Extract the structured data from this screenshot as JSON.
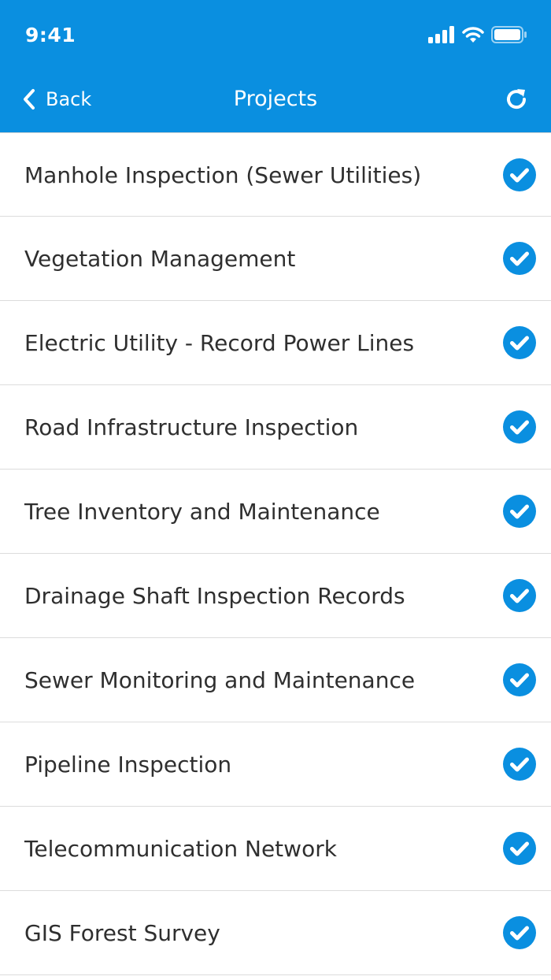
{
  "status_bar": {
    "time": "9:41",
    "icons": [
      "signal-icon",
      "wifi-icon",
      "battery-icon"
    ]
  },
  "nav": {
    "back_label": "Back",
    "title": "Projects",
    "back_icon": "chevron-left-icon",
    "refresh_icon": "refresh-icon"
  },
  "colors": {
    "header": "#0A8FE0",
    "check": "#0A8FE0",
    "text": "#2f2f2f",
    "divider": "#dcdcdc"
  },
  "projects": [
    {
      "label": "Manhole Inspection (Sewer Utilities)",
      "checked": true
    },
    {
      "label": "Vegetation Management",
      "checked": true
    },
    {
      "label": "Electric Utility - Record Power Lines",
      "checked": true
    },
    {
      "label": "Road Infrastructure Inspection",
      "checked": true
    },
    {
      "label": "Tree Inventory and Maintenance",
      "checked": true
    },
    {
      "label": "Drainage Shaft Inspection Records",
      "checked": true
    },
    {
      "label": "Sewer Monitoring and Maintenance",
      "checked": true
    },
    {
      "label": "Pipeline Inspection",
      "checked": true
    },
    {
      "label": "Telecommunication Network",
      "checked": true
    },
    {
      "label": "GIS Forest Survey",
      "checked": true
    }
  ]
}
